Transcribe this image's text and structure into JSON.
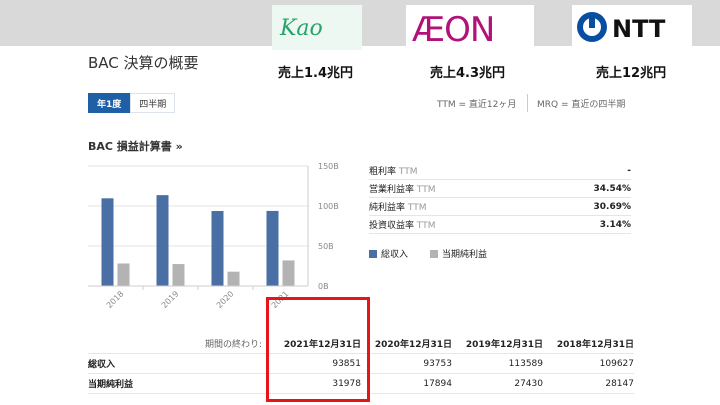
{
  "logos": [
    {
      "name": "Kao",
      "caption": "売上1.4兆円"
    },
    {
      "name": "AEON",
      "caption": "売上4.3兆円"
    },
    {
      "name": "NTT",
      "caption": "売上12兆円"
    }
  ],
  "page": {
    "title": "BAC 決算の概要"
  },
  "tabs": [
    {
      "label": "年1度",
      "active": true
    },
    {
      "label": "四半期",
      "active": false
    }
  ],
  "legend_top": {
    "ttm": "TTM = 直近12ヶ月",
    "mrq": "MRQ = 直近の四半期"
  },
  "section": {
    "title": "BAC 損益計算書 »"
  },
  "chart_data": {
    "type": "bar",
    "categories": [
      "2018",
      "2019",
      "2020",
      "2021"
    ],
    "series": [
      {
        "name": "総収入",
        "values": [
          109627,
          113589,
          93753,
          93851
        ],
        "color": "#4a6fa5"
      },
      {
        "name": "当期純利益",
        "values": [
          28147,
          27430,
          17894,
          31978
        ],
        "color": "#b3b3b3"
      }
    ],
    "ylim": [
      0,
      150000
    ],
    "yticks": [
      {
        "value": 150000,
        "label": "150B"
      },
      {
        "value": 100000,
        "label": "100B"
      },
      {
        "value": 50000,
        "label": "50B"
      },
      {
        "value": 0,
        "label": "0B"
      }
    ],
    "grid": true
  },
  "ratios": [
    {
      "label": "粗利率",
      "ttm": "TTM",
      "value": "-"
    },
    {
      "label": "営業利益率",
      "ttm": "TTM",
      "value": "34.54%"
    },
    {
      "label": "純利益率",
      "ttm": "TTM",
      "value": "30.69%"
    },
    {
      "label": "投資収益率",
      "ttm": "TTM",
      "value": "3.14%"
    }
  ],
  "legend": {
    "revenue": "総収入",
    "net_income": "当期純利益"
  },
  "table": {
    "header_label": "期間の終わり:",
    "columns": [
      "2021年12月31日",
      "2020年12月31日",
      "2019年12月31日",
      "2018年12月31日"
    ],
    "rows": [
      {
        "label": "総収入",
        "values": [
          "93851",
          "93753",
          "113589",
          "109627"
        ]
      },
      {
        "label": "当期純利益",
        "values": [
          "31978",
          "17894",
          "27430",
          "28147"
        ]
      }
    ]
  },
  "colors": {
    "accent": "#1f5fa6",
    "highlight": "#e8141c",
    "kao": "#2aa36b",
    "aeon": "#b0127a",
    "ntt": "#0a4ea2"
  }
}
